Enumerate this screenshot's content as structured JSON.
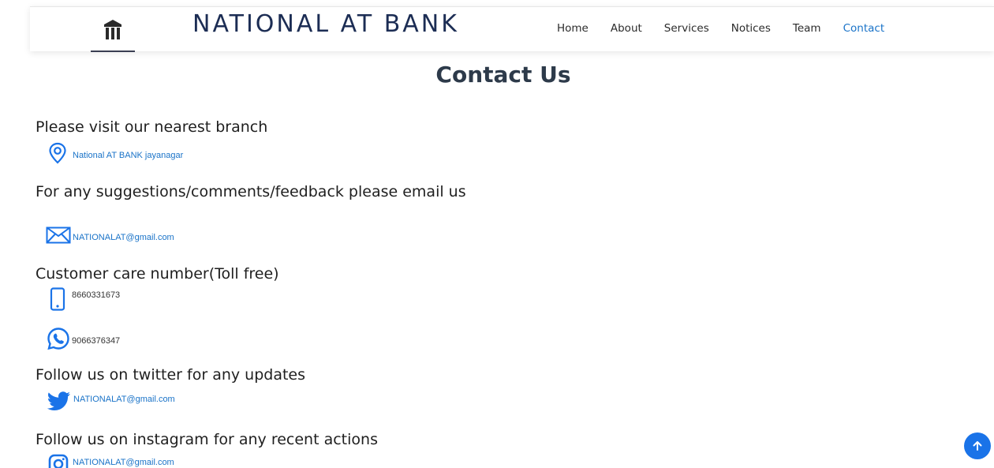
{
  "header": {
    "brand": "NATIONAL AT BANK",
    "nav": [
      "Home",
      "About",
      "Services",
      "Notices",
      "Team",
      "Contact"
    ],
    "active_nav": "Contact"
  },
  "main": {
    "title": "Contact Us",
    "branch": {
      "heading": "Please visit our nearest branch",
      "text": "National AT BANK jayanagar",
      "icon": "location-icon"
    },
    "email": {
      "heading": "For any suggestions/comments/feedback please email us",
      "text": "NATIONALAT@gmail.com",
      "icon": "mail-icon"
    },
    "customer_care": {
      "heading": "Customer care number(Toll free)",
      "phone": "8660331673",
      "phone_icon": "mobile-phone-icon",
      "whatsapp": "9066376347",
      "whatsapp_icon": "whatsapp-icon"
    },
    "twitter": {
      "heading": "Follow us on twitter for any updates",
      "text": "NATIONALAT@gmail.com",
      "icon": "twitter-icon"
    },
    "instagram": {
      "heading": "Follow us on instagram for any recent actions",
      "text": "NATIONALAT@gmail.com",
      "icon": "instagram-icon"
    }
  },
  "colors": {
    "accent": "#1a73e8",
    "link": "#1a73c8",
    "brand": "#1c2d54"
  },
  "scroll_top_icon": "arrow-up-icon"
}
